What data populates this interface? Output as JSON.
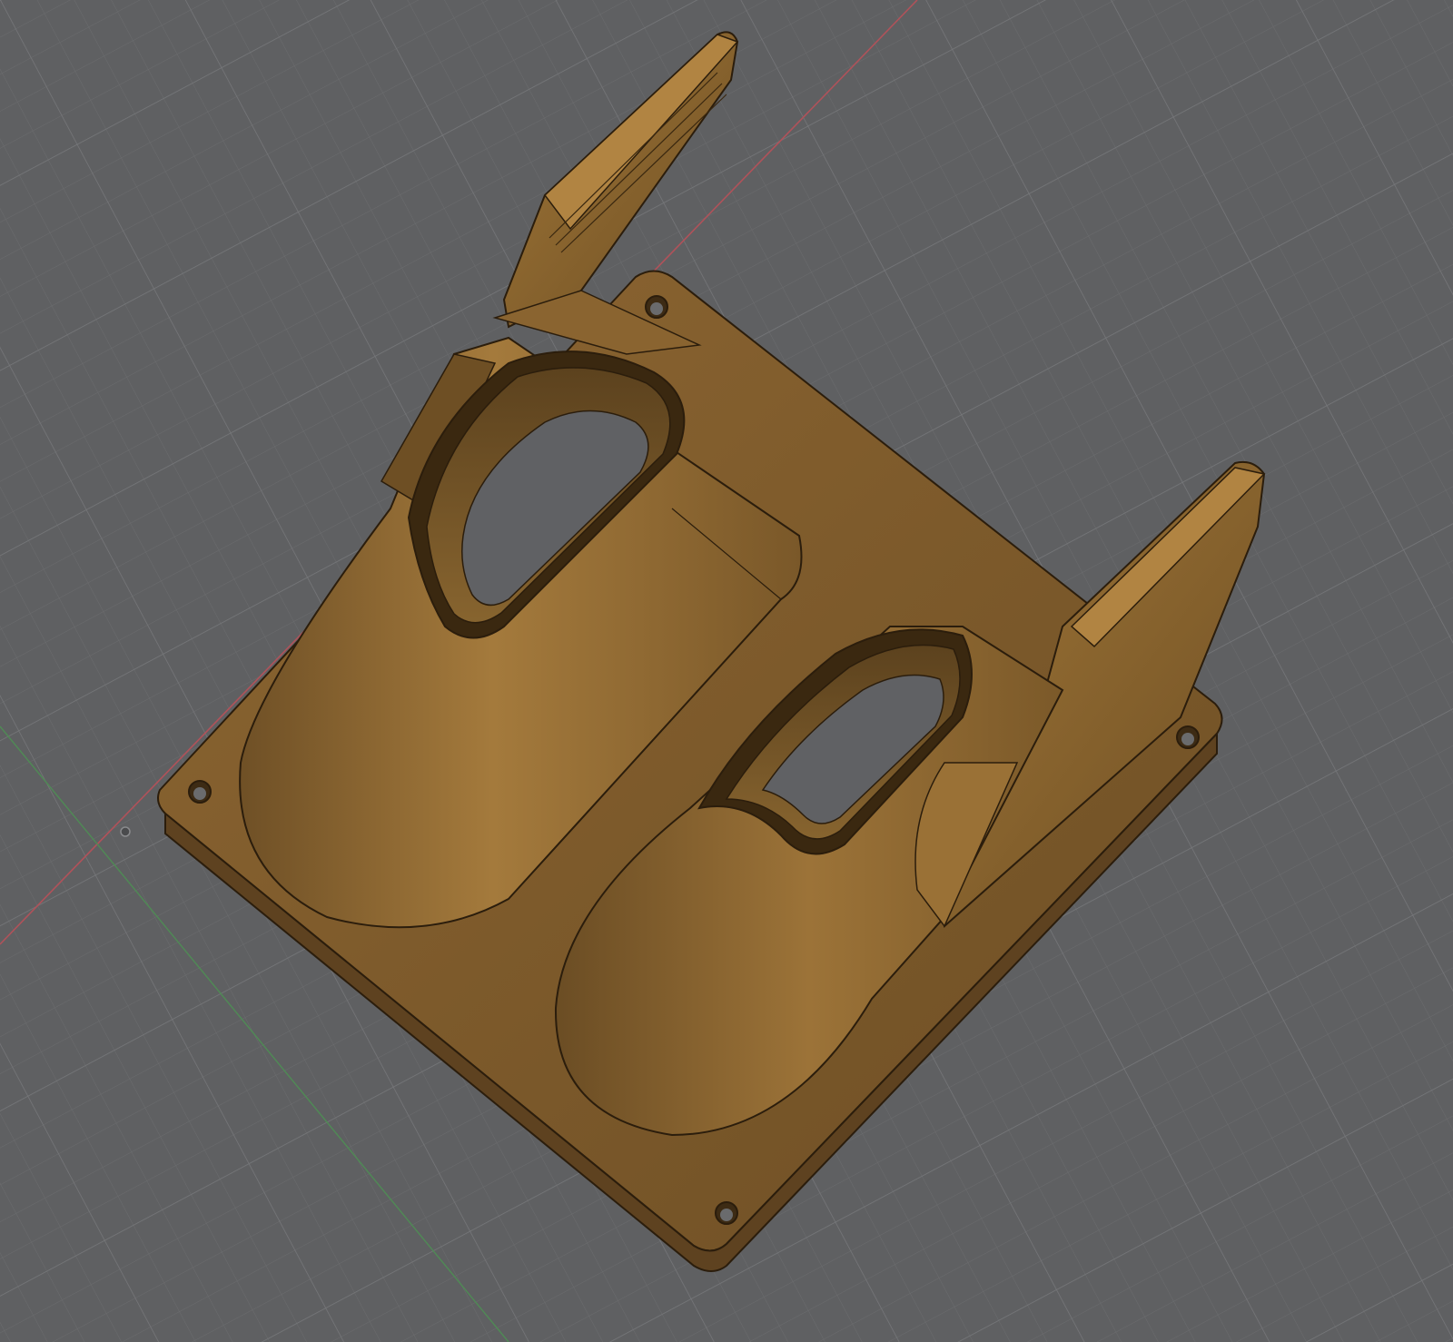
{
  "viewport": {
    "background_color": "#5f6062",
    "grid_minor_color": "#6a6b6d",
    "grid_major_color": "#747577",
    "axis_x_color": "#b0525a",
    "axis_y_color": "#4f8a55",
    "origin_marker_icon": "origin-point-icon"
  },
  "model": {
    "material_color": "#8a6430",
    "highlight_color": "#a57a3a",
    "shadow_color": "#5e4220",
    "edge_color": "#2b1d0c",
    "section_hatch_color": "#3a2810",
    "mounting_holes": 4,
    "air_duct_nozzles": 2,
    "mounting_clips": 2
  }
}
